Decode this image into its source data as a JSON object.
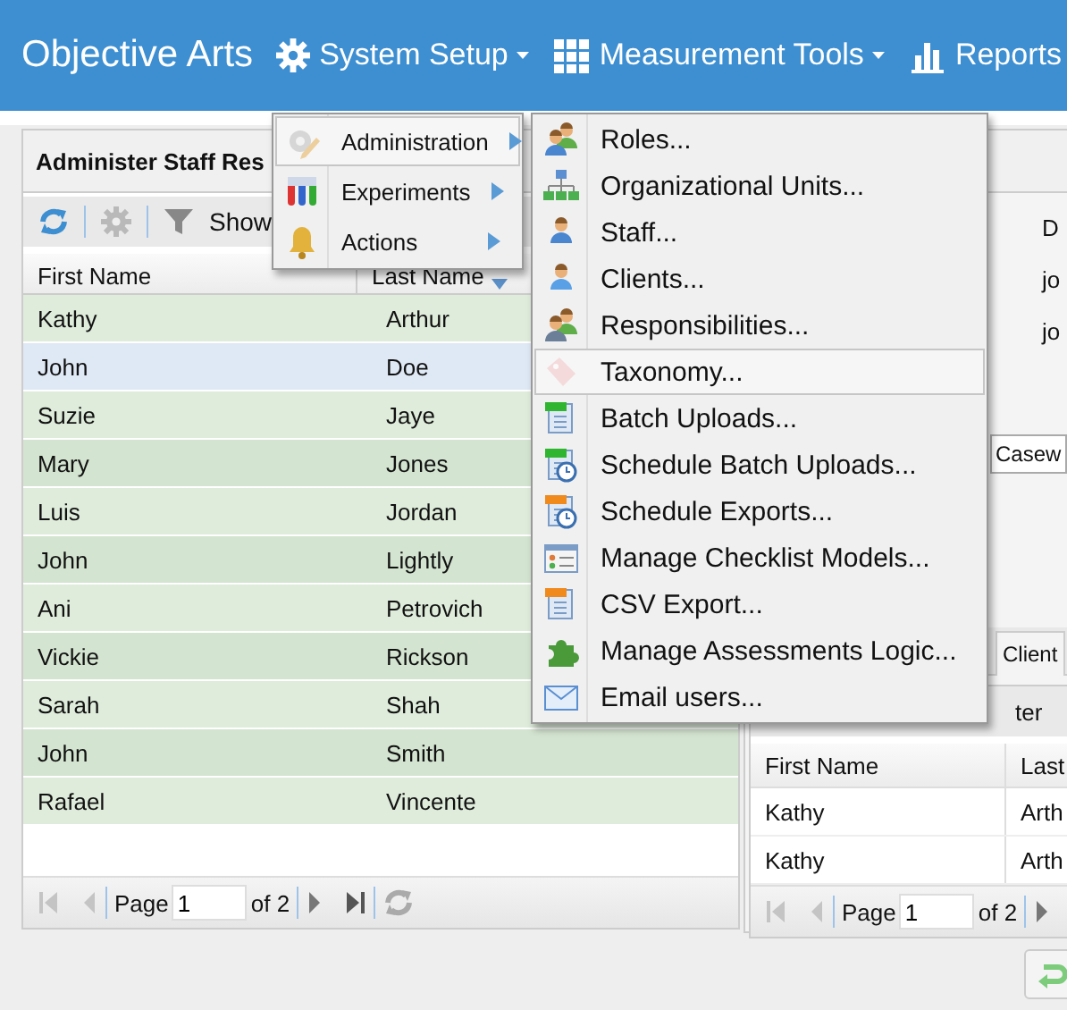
{
  "app": {
    "title": "Objective Arts"
  },
  "nav": [
    {
      "label": "System Setup",
      "caret": true
    },
    {
      "label": "Measurement Tools",
      "caret": true
    },
    {
      "label": "Reports",
      "caret": false
    }
  ],
  "staff_panel": {
    "title": "Administer Staff Res",
    "filter_label": "Show",
    "columns": [
      {
        "label": "First Name"
      },
      {
        "label": "Last Name"
      }
    ],
    "rows": [
      {
        "first": "Kathy",
        "last": "Arthur",
        "selected": false
      },
      {
        "first": "John",
        "last": "Doe",
        "selected": true
      },
      {
        "first": "Suzie",
        "last": "Jaye",
        "selected": false
      },
      {
        "first": "Mary",
        "last": "Jones",
        "selected": false
      },
      {
        "first": "Luis",
        "last": "Jordan",
        "selected": false
      },
      {
        "first": "John",
        "last": "Lightly",
        "selected": false
      },
      {
        "first": "Ani",
        "last": "Petrovich",
        "selected": false
      },
      {
        "first": "Vickie",
        "last": "Rickson",
        "selected": false
      },
      {
        "first": "Sarah",
        "last": "Shah",
        "selected": false
      },
      {
        "first": "John",
        "last": "Smith",
        "selected": false
      },
      {
        "first": "Rafael",
        "last": "Vincente",
        "selected": false
      }
    ],
    "pager": {
      "label": "Page",
      "page": "1",
      "of": "of 2"
    }
  },
  "detail_panel": {
    "texts": [
      "D",
      "jo",
      "jo"
    ],
    "field_value": "Casew",
    "tab": "Client",
    "toolbar_text": "ter",
    "columns": [
      {
        "label": "First Name"
      },
      {
        "label": "Last"
      }
    ],
    "rows": [
      {
        "first": "Kathy",
        "last": "Arth"
      },
      {
        "first": "Kathy",
        "last": "Arth"
      }
    ],
    "pager": {
      "label": "Page",
      "page": "1",
      "of": "of 2"
    }
  },
  "menu": {
    "items": [
      {
        "label": "Administration",
        "selected": true
      },
      {
        "label": "Experiments",
        "selected": false
      },
      {
        "label": "Actions",
        "selected": false
      }
    ]
  },
  "submenu": {
    "items": [
      {
        "label": "Roles...",
        "selected": false
      },
      {
        "label": "Organizational Units...",
        "selected": false
      },
      {
        "label": "Staff...",
        "selected": false
      },
      {
        "label": "Clients...",
        "selected": false
      },
      {
        "label": "Responsibilities...",
        "selected": false
      },
      {
        "label": "Taxonomy...",
        "selected": true
      },
      {
        "label": "Batch Uploads...",
        "selected": false
      },
      {
        "label": "Schedule Batch Uploads...",
        "selected": false
      },
      {
        "label": "Schedule Exports...",
        "selected": false
      },
      {
        "label": "Manage Checklist Models...",
        "selected": false
      },
      {
        "label": "CSV Export...",
        "selected": false
      },
      {
        "label": "Manage Assessments Logic...",
        "selected": false
      },
      {
        "label": "Email users...",
        "selected": false
      }
    ]
  }
}
